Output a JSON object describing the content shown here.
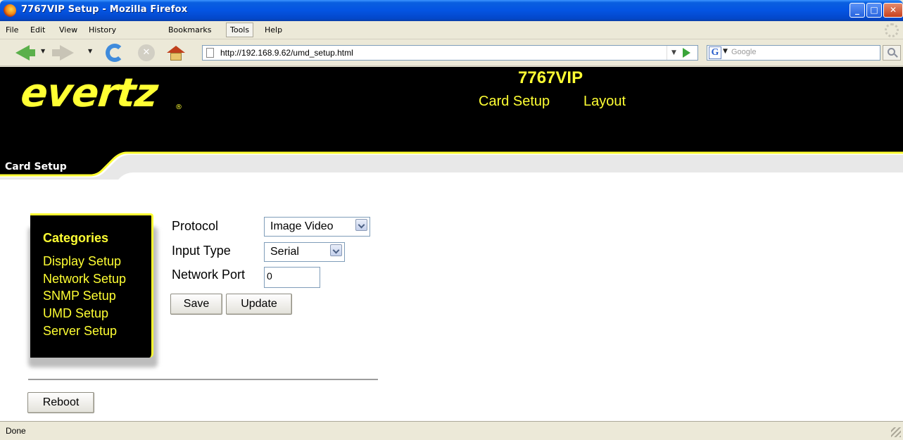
{
  "window": {
    "title": "7767VIP Setup - Mozilla Firefox",
    "min_glyph": "_",
    "max_glyph": "□",
    "close_glyph": "✕"
  },
  "menu": {
    "items": [
      "File",
      "Edit",
      "View",
      "History",
      "Bookmarks",
      "Tools",
      "Help"
    ],
    "active": "Tools"
  },
  "toolbar": {
    "url": "http://192.168.9.62/umd_setup.html",
    "search_placeholder": "Google",
    "search_engine_glyph": "G",
    "stop_glyph": "✕"
  },
  "header": {
    "logo": "evertz",
    "logo_mark": "®",
    "model": "7767VIP",
    "links": [
      "Card Setup",
      "Layout"
    ],
    "tab_label": "Card Setup"
  },
  "categories": {
    "title": "Categories",
    "items": [
      "Display Setup",
      "Network Setup",
      "SNMP Setup",
      "UMD Setup",
      "Server Setup"
    ]
  },
  "form": {
    "protocol_label": "Protocol",
    "protocol_value": "Image Video",
    "input_type_label": "Input Type",
    "input_type_value": "Serial",
    "network_port_label": "Network Port",
    "network_port_value": "0",
    "save_label": "Save",
    "update_label": "Update",
    "reboot_label": "Reboot"
  },
  "status": {
    "text": "Done"
  },
  "colors": {
    "brand_yellow": "#ffff33",
    "header_black": "#000000",
    "xp_titlebar": "#0454e2"
  }
}
